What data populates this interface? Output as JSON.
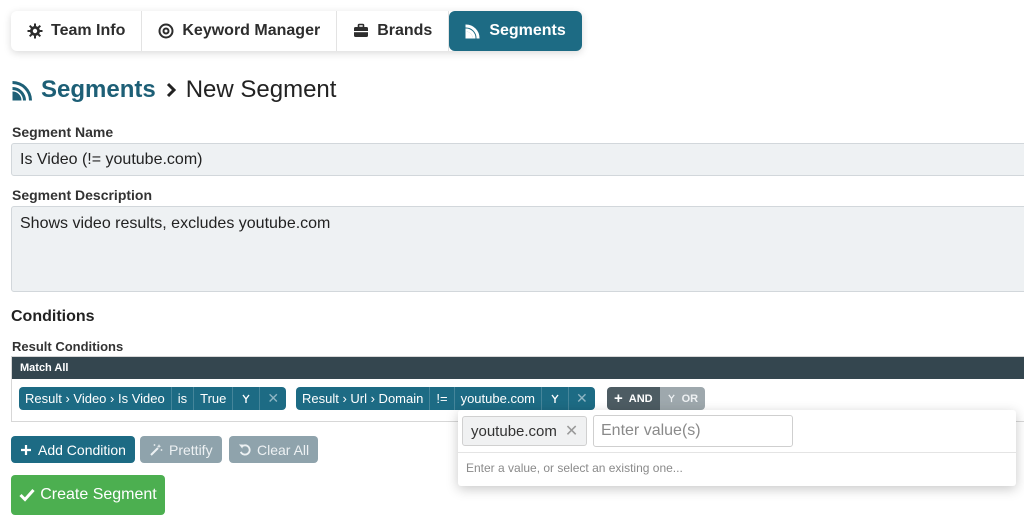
{
  "tabs": [
    {
      "label": "Team Info",
      "icon": "gear-icon"
    },
    {
      "label": "Keyword Manager",
      "icon": "target-icon"
    },
    {
      "label": "Brands",
      "icon": "briefcase-icon"
    },
    {
      "label": "Segments",
      "icon": "segments-icon",
      "active": true
    }
  ],
  "breadcrumb": {
    "root": "Segments",
    "current": "New Segment"
  },
  "form": {
    "name_label": "Segment Name",
    "name_value": "Is Video (!= youtube.com)",
    "desc_label": "Segment Description",
    "desc_value": "Shows video results, excludes youtube.com"
  },
  "conditions": {
    "title": "Conditions",
    "result_label": "Result Conditions",
    "match_header": "Match All",
    "items": [
      {
        "field": "Result › Video › Is Video",
        "op": "is",
        "value": "True"
      },
      {
        "field": "Result › Url › Domain",
        "op": "!=",
        "value": "youtube.com"
      }
    ],
    "and_label": "AND",
    "or_label": "OR"
  },
  "buttons": {
    "add": "Add Condition",
    "prettify": "Prettify",
    "clear": "Clear All",
    "create": "Create Segment"
  },
  "dropdown": {
    "chip": "youtube.com",
    "placeholder": "Enter value(s)",
    "hint": "Enter a value, or select an existing one..."
  },
  "colors": {
    "primary": "#1d6b84",
    "header_dark": "#34464f",
    "success": "#4caf50",
    "muted": "#8fa3ac"
  }
}
